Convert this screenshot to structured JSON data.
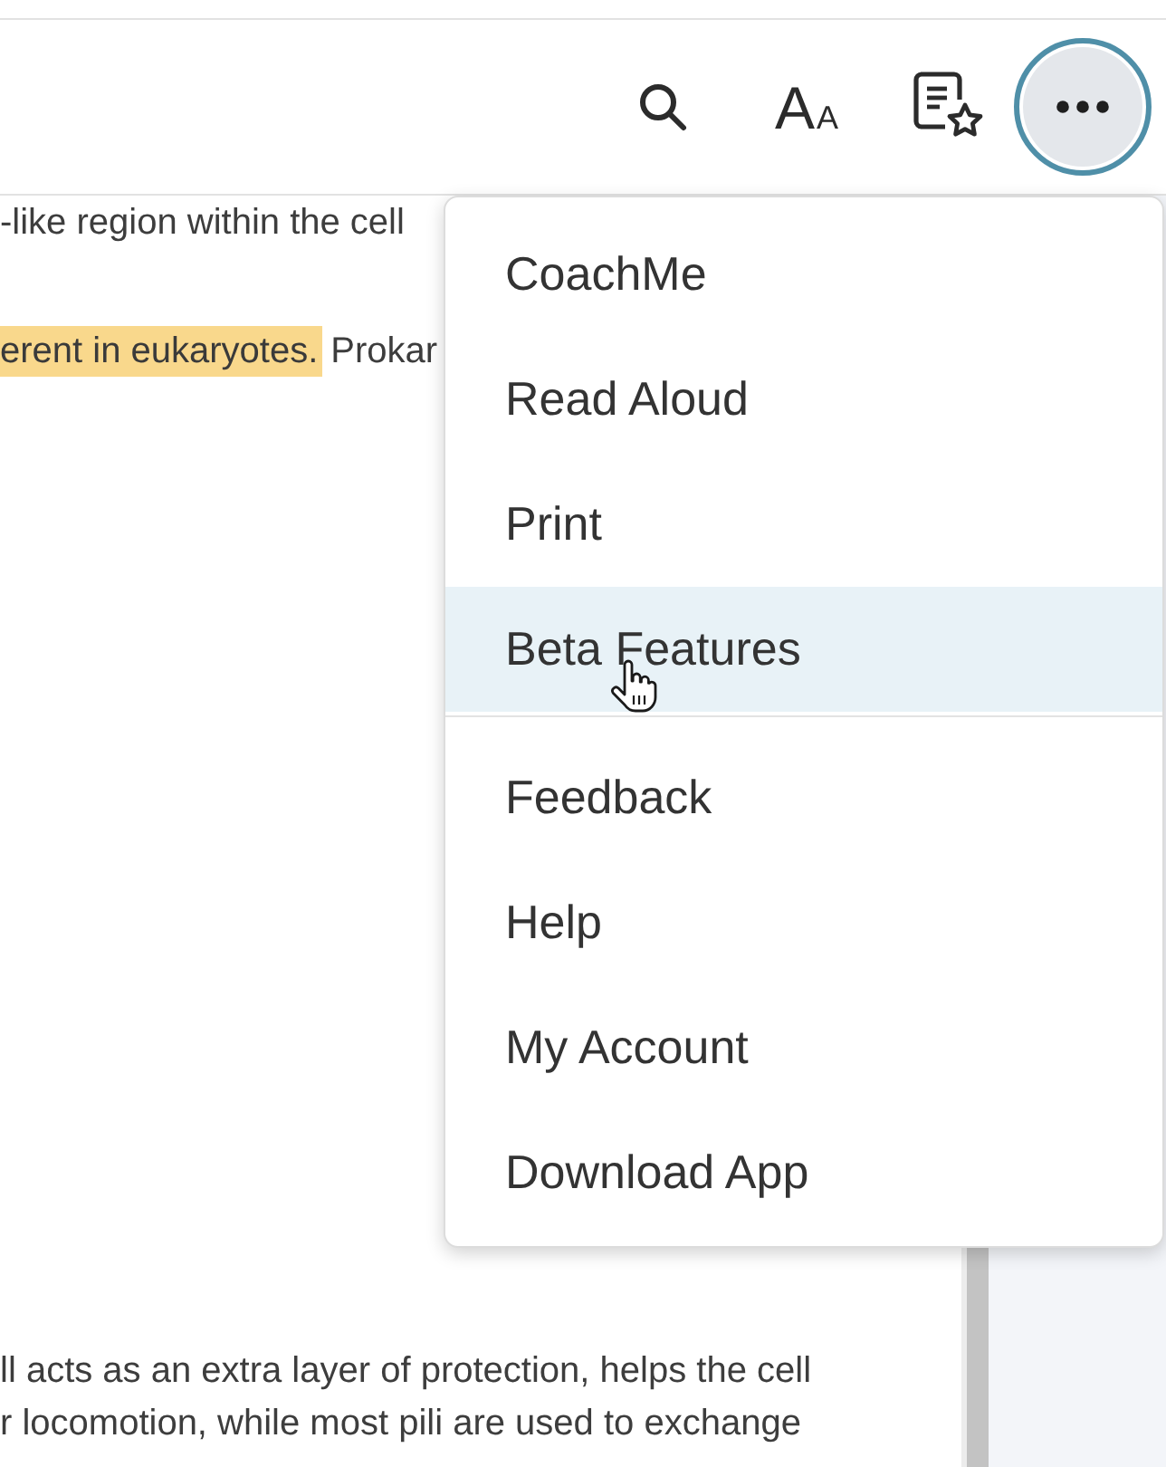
{
  "toolbar": {
    "text_size_button": {
      "label": "A",
      "small_label": "A"
    },
    "more_button": {
      "expanded": true
    }
  },
  "article": {
    "paragraphs": [
      {
        "lines": [
          {
            "segments": [
              {
                "text": "-like region within the cell",
                "highlighted": false
              }
            ]
          }
        ]
      },
      {
        "lines": [
          {
            "segments": [
              {
                "text": "erent in eukaryotes.",
                "highlighted": true
              },
              {
                "text": "Prokar",
                "highlighted": false
              }
            ]
          }
        ]
      },
      {
        "lines": [
          {
            "segments": [
              {
                "text": "ll acts as an extra layer of protection, helps the cell",
                "highlighted": false
              }
            ]
          },
          {
            "segments": [
              {
                "text": "r locomotion, while most pili are used to exchange",
                "highlighted": false
              }
            ]
          }
        ]
      }
    ]
  },
  "menu": {
    "groups": [
      {
        "items": [
          {
            "label": "CoachMe",
            "hovered": false
          },
          {
            "label": "Read Aloud",
            "hovered": false
          },
          {
            "label": "Print",
            "hovered": false
          },
          {
            "label": "Beta Features",
            "hovered": true
          }
        ]
      },
      {
        "items": [
          {
            "label": "Feedback",
            "hovered": false
          },
          {
            "label": "Help",
            "hovered": false
          },
          {
            "label": "My Account",
            "hovered": false
          },
          {
            "label": "Download App",
            "hovered": false
          }
        ]
      }
    ]
  }
}
